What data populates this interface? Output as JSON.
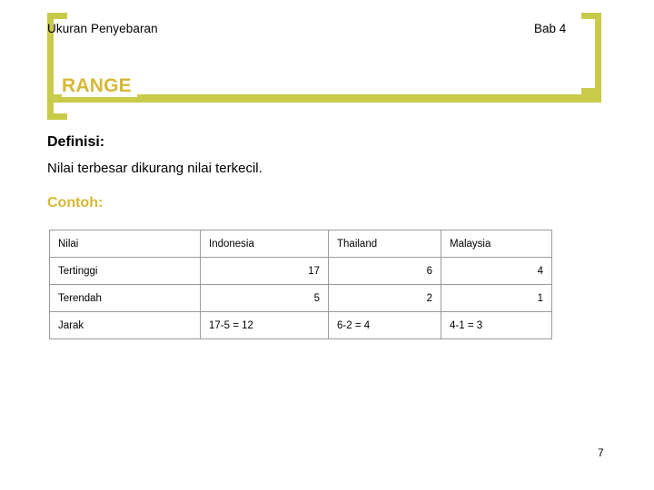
{
  "header": {
    "left": "Ukuran Penyebaran",
    "right": "Bab 4"
  },
  "title": "RANGE",
  "body": {
    "definisi_label": "Definisi:",
    "definisi_text": "Nilai terbesar dikurang nilai terkecil.",
    "contoh_label": "Contoh:"
  },
  "table": {
    "headers": [
      "Nilai",
      "Indonesia",
      "Thailand",
      "Malaysia"
    ],
    "rows": [
      {
        "label": "Tertinggi",
        "cells": [
          "17",
          "6",
          "4"
        ],
        "align": "num"
      },
      {
        "label": "Terendah",
        "cells": [
          "5",
          "2",
          "1"
        ],
        "align": "num"
      },
      {
        "label": "Jarak",
        "cells": [
          "17-5 = 12",
          "6-2 = 4",
          "4-1 = 3"
        ],
        "align": "txt"
      }
    ]
  },
  "footer": {
    "page_number": "7"
  },
  "colors": {
    "accent_yellow": "#c9c94a",
    "title_gold": "#d7b836",
    "text_black": "#000000",
    "table_border": "#9a9a9a"
  }
}
